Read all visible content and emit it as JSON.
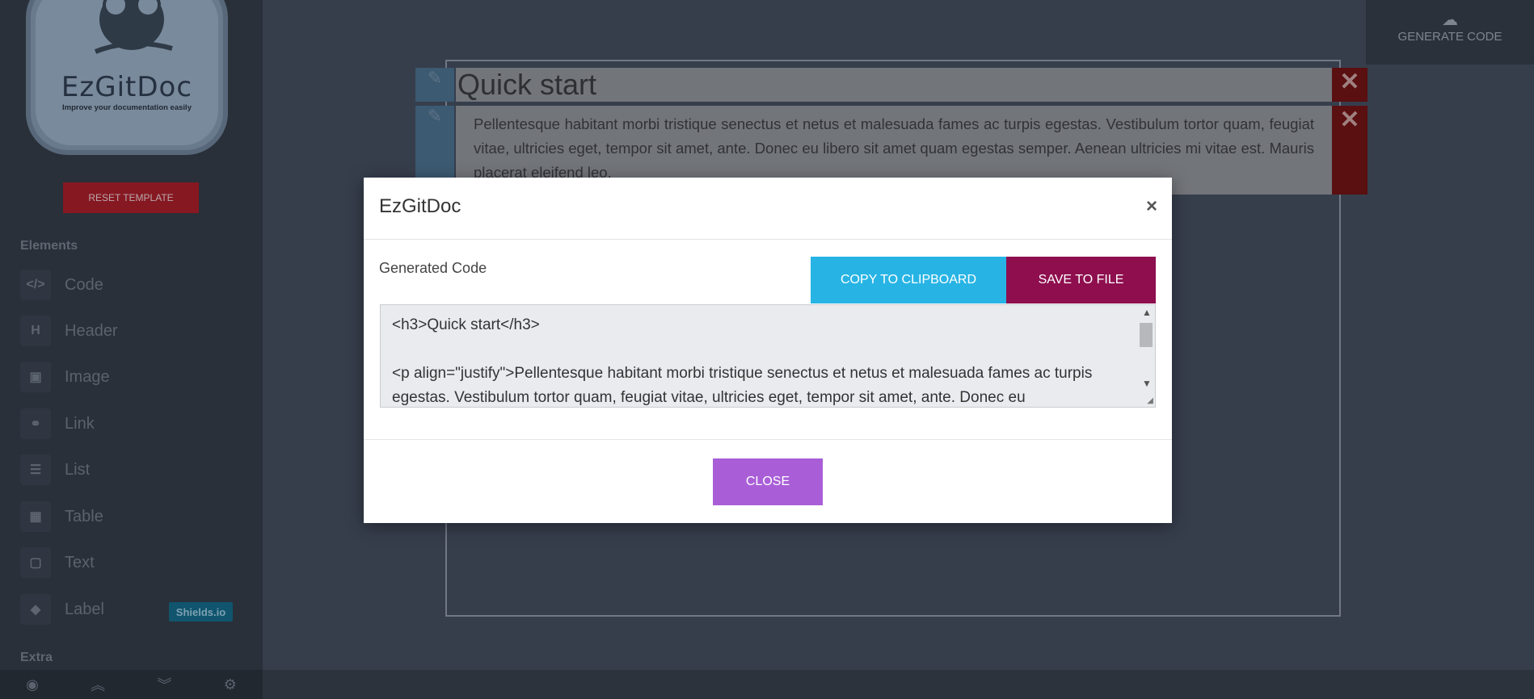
{
  "sidebar": {
    "logo_text": "EzGitDoc",
    "logo_subtitle": "Improve your documentation easily",
    "reset_label": "RESET TEMPLATE",
    "elements_title": "Elements",
    "items": [
      {
        "label": "Code",
        "icon": "code-icon",
        "glyph": "</>"
      },
      {
        "label": "Header",
        "icon": "header-icon",
        "glyph": "H"
      },
      {
        "label": "Image",
        "icon": "image-icon",
        "glyph": "▣"
      },
      {
        "label": "Link",
        "icon": "link-icon",
        "glyph": "⚭"
      },
      {
        "label": "List",
        "icon": "list-icon",
        "glyph": "☰"
      },
      {
        "label": "Table",
        "icon": "table-icon",
        "glyph": "▦"
      },
      {
        "label": "Text",
        "icon": "text-icon",
        "glyph": "▢"
      },
      {
        "label": "Label",
        "icon": "tag-icon",
        "glyph": "◆"
      }
    ],
    "shields_badge": "Shields.io",
    "extra_title": "Extra",
    "bottom_icons": [
      "eye-icon",
      "double-chevron-up-icon",
      "double-chevron-down-icon",
      "gear-icon"
    ]
  },
  "topbar": {
    "generate_label": "GENERATE CODE",
    "generate_icon": "generate-code-icon"
  },
  "canvas": {
    "title_row": "Quick start",
    "paragraph_row": "Pellentesque habitant morbi tristique senectus et netus et malesuada fames ac turpis egestas. Vestibulum tortor quam, feugiat vitae, ultricies eget, tempor sit amet, ante. Donec eu libero sit amet quam egestas semper. Aenean ultricies mi vitae est. Mauris placerat eleifend leo."
  },
  "modal": {
    "title": "EzGitDoc",
    "close_x": "×",
    "generated_label": "Generated Code",
    "copy_label": "COPY TO CLIPBOARD",
    "save_label": "SAVE TO FILE",
    "code": "<h3>Quick start</h3>\n\n<p align=\"justify\">Pellentesque habitant morbi tristique senectus et netus et malesuada fames ac turpis egestas. Vestibulum tortor quam, feugiat vitae, ultricies eget, tempor sit amet, ante. Donec eu",
    "close_label": "CLOSE"
  },
  "colors": {
    "copy_button": "#27b4e4",
    "save_button": "#8e0e4e",
    "close_button": "#a95ed7",
    "reset_button": "#861821",
    "delete_button": "#5a0f10"
  }
}
